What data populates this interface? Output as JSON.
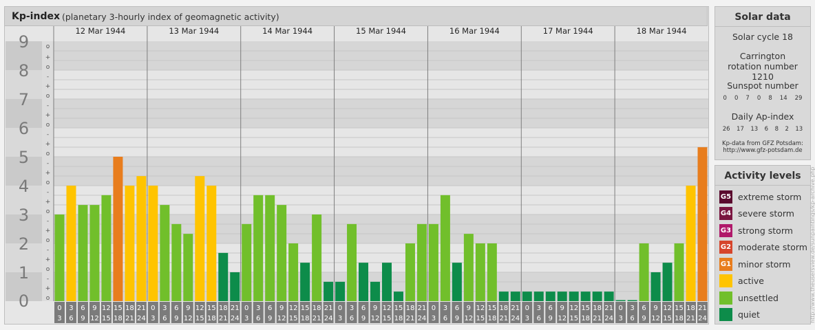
{
  "header": {
    "title": "Kp-index",
    "subtitle": "(planetary 3-hourly index of geomagnetic activity)"
  },
  "chart_data": {
    "type": "bar",
    "ylim": [
      0,
      9
    ],
    "y_ticks": [
      "0",
      "1",
      "2",
      "3",
      "4",
      "5",
      "6",
      "7",
      "8",
      "9"
    ],
    "sub_ticks": [
      "+",
      "o",
      "-"
    ],
    "days": [
      "12 Mar 1944",
      "13 Mar 1944",
      "14 Mar 1944",
      "15 Mar 1944",
      "16 Mar 1944",
      "17 Mar 1944",
      "18 Mar 1944"
    ],
    "interval_start": [
      "0",
      "3",
      "6",
      "9",
      "12",
      "15",
      "18",
      "21"
    ],
    "interval_end": [
      "3",
      "6",
      "9",
      "12",
      "15",
      "18",
      "21",
      "24"
    ],
    "values": [
      [
        3,
        4,
        3.33,
        3.33,
        3.67,
        5,
        4,
        4.33
      ],
      [
        4,
        3.33,
        2.67,
        2.33,
        4.33,
        4,
        1.67,
        1
      ],
      [
        2.67,
        3.67,
        3.67,
        3.33,
        2,
        1.33,
        3,
        0.67
      ],
      [
        0.67,
        2.67,
        1.33,
        0.67,
        1.33,
        0.33,
        2,
        2.67
      ],
      [
        2.67,
        3.67,
        1.33,
        2.33,
        2,
        2,
        0.33,
        0.33
      ],
      [
        0.33,
        0.33,
        0.33,
        0.33,
        0.33,
        0.33,
        0.33,
        0.33
      ],
      [
        0,
        0,
        2,
        1,
        1.33,
        2,
        4,
        5.33
      ]
    ],
    "level_colors": {
      "quiet": "#0d8c4a",
      "unsettled": "#71bf2b",
      "active": "#ffc400",
      "minor": "#e87d1d"
    }
  },
  "solar": {
    "title": "Solar data",
    "cycle": "Solar cycle 18",
    "carrington": "Carrington rotation number 1210",
    "sunspot_label": "Sunspot number",
    "sunspot_values": [
      "0",
      "0",
      "7",
      "0",
      "8",
      "14",
      "29"
    ],
    "ap_label": "Daily Ap-index",
    "ap_values": [
      "26",
      "17",
      "13",
      "6",
      "8",
      "2",
      "13"
    ],
    "source": "Kp-data from GFZ Potsdam:",
    "source_url": "http://www.gfz-potsdam.de"
  },
  "legend": {
    "title": "Activity levels",
    "items": [
      {
        "code": "G5",
        "label": "extreme storm",
        "color": "#5a0a2e"
      },
      {
        "code": "G4",
        "label": "severe storm",
        "color": "#7a1540"
      },
      {
        "code": "G3",
        "label": "strong storm",
        "color": "#b0196a"
      },
      {
        "code": "G2",
        "label": "moderate storm",
        "color": "#d6452c"
      },
      {
        "code": "G1",
        "label": "minor storm",
        "color": "#e87d1d"
      },
      {
        "code": "",
        "label": "active",
        "color": "#ffc400"
      },
      {
        "code": "",
        "label": "unsettled",
        "color": "#71bf2b"
      },
      {
        "code": "",
        "label": "quiet",
        "color": "#0d8c4a"
      }
    ]
  },
  "watermark": "http://www.theusersview.de/sunpaintings/kp-archive.php"
}
